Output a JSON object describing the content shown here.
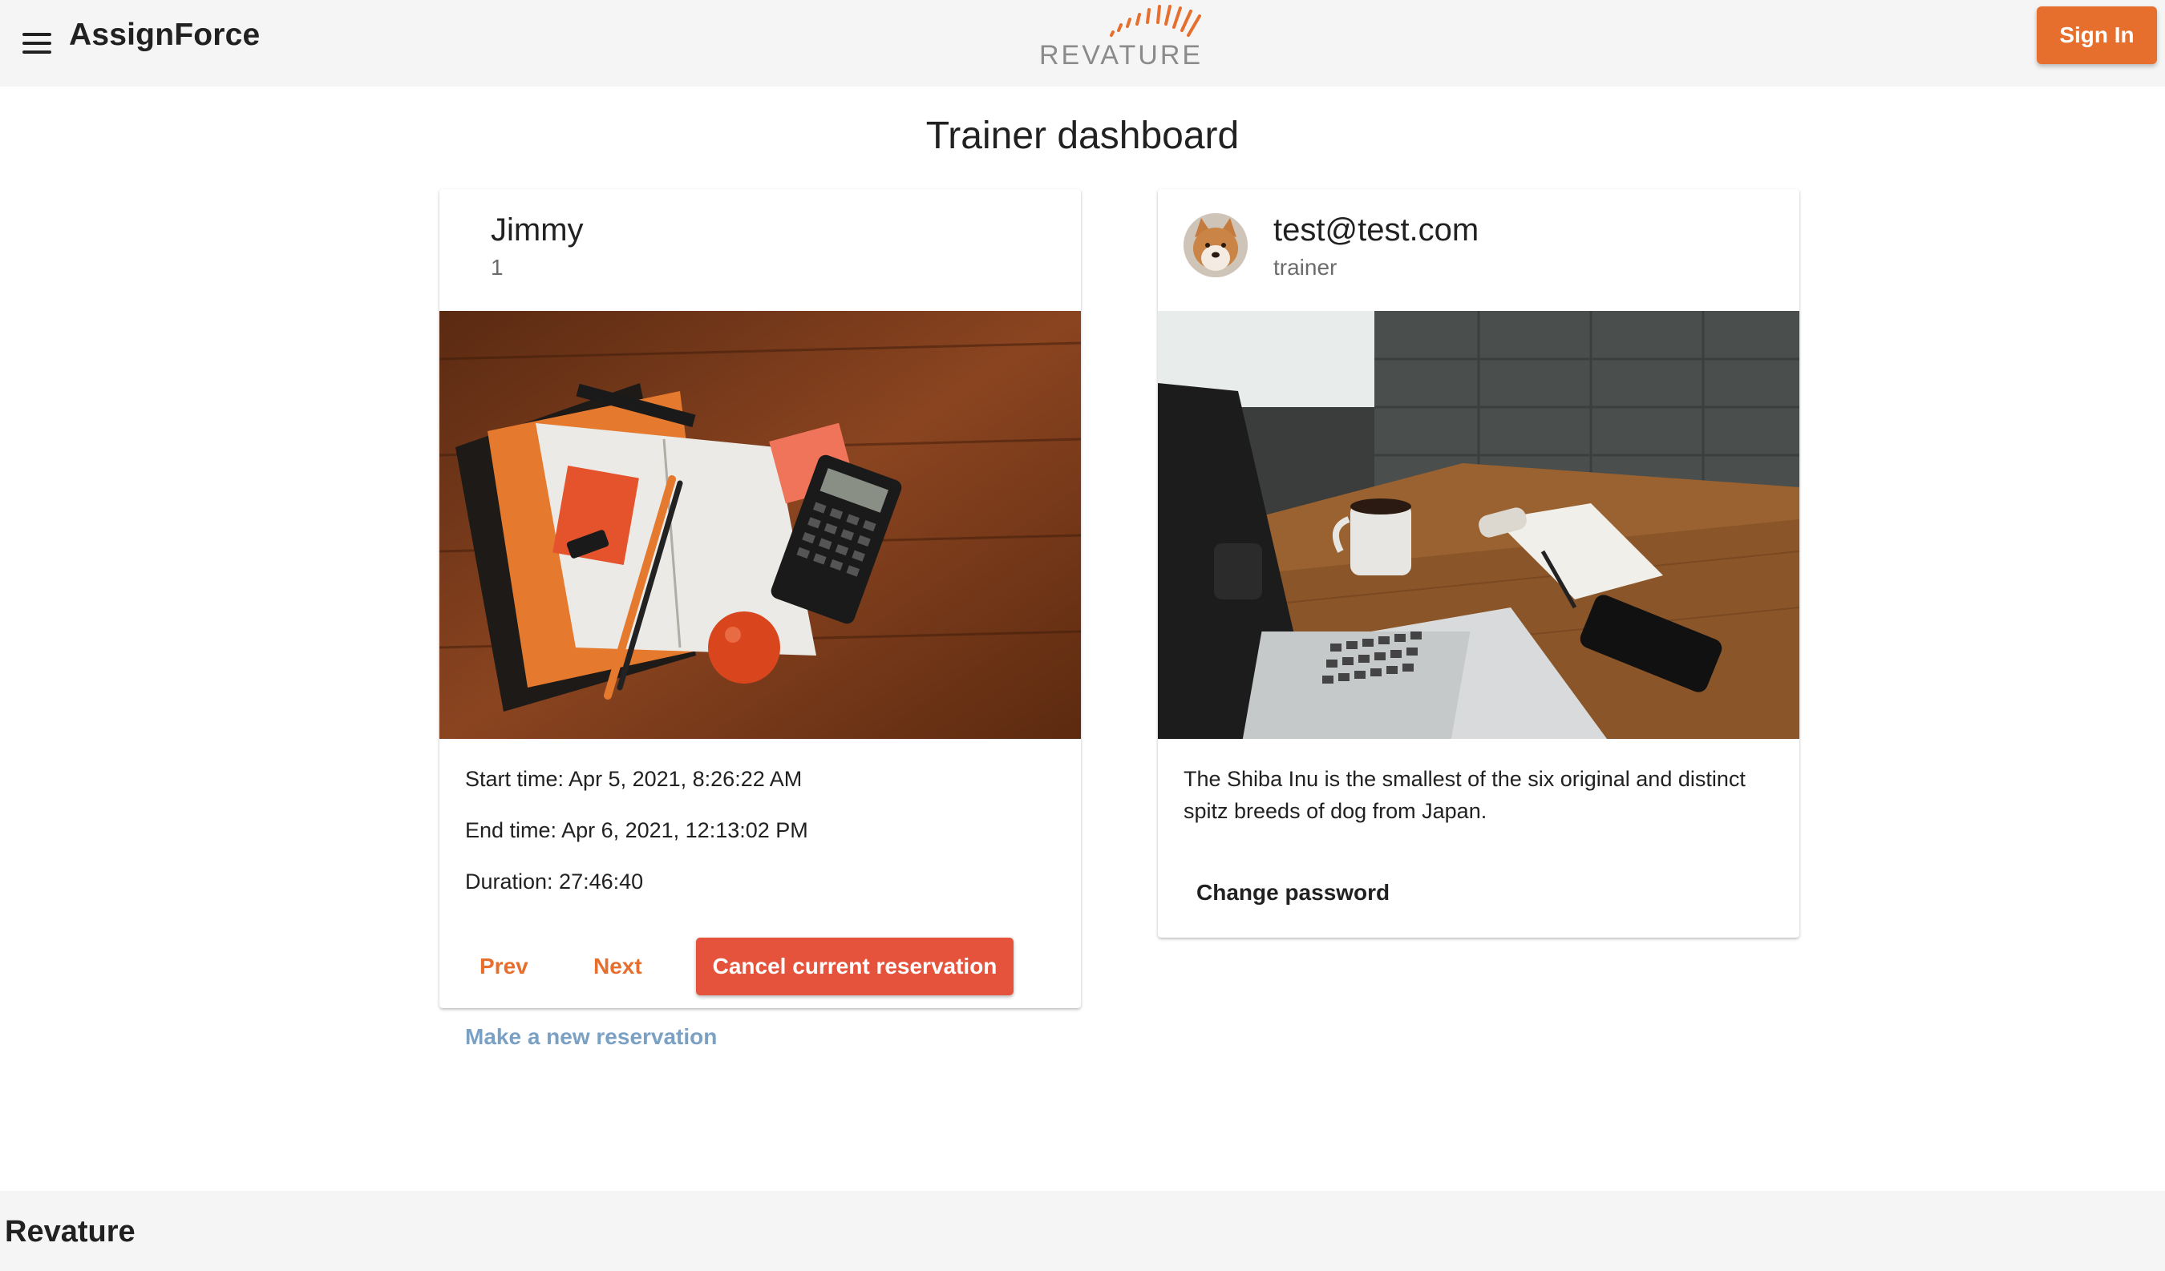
{
  "appbar": {
    "title": "AssignForce",
    "logo_text": "REVATURE",
    "signin_label": "Sign In",
    "accent_color": "#e76f2e"
  },
  "page": {
    "heading": "Trainer dashboard"
  },
  "reservation_card": {
    "title": "Jimmy",
    "subtitle": "1",
    "start_time": "Start time: Apr 5, 2021, 8:26:22 AM",
    "end_time": "End time: Apr 6, 2021, 12:13:02 PM",
    "duration": "Duration: 27:46:40",
    "prev_label": "Prev",
    "next_label": "Next",
    "cancel_label": "Cancel current reservation",
    "image_icon": "notebook-desk-photo"
  },
  "new_reservation_link": "Make a new reservation",
  "profile_card": {
    "title": "test@test.com",
    "subtitle": "trainer",
    "description": "The Shiba Inu is the smallest of the six original and distinct spitz breeds of dog from Japan.",
    "change_password_label": "Change password",
    "avatar_icon": "shiba-inu-avatar",
    "image_icon": "laptop-desk-photo"
  },
  "footer": {
    "text": "Revature"
  }
}
